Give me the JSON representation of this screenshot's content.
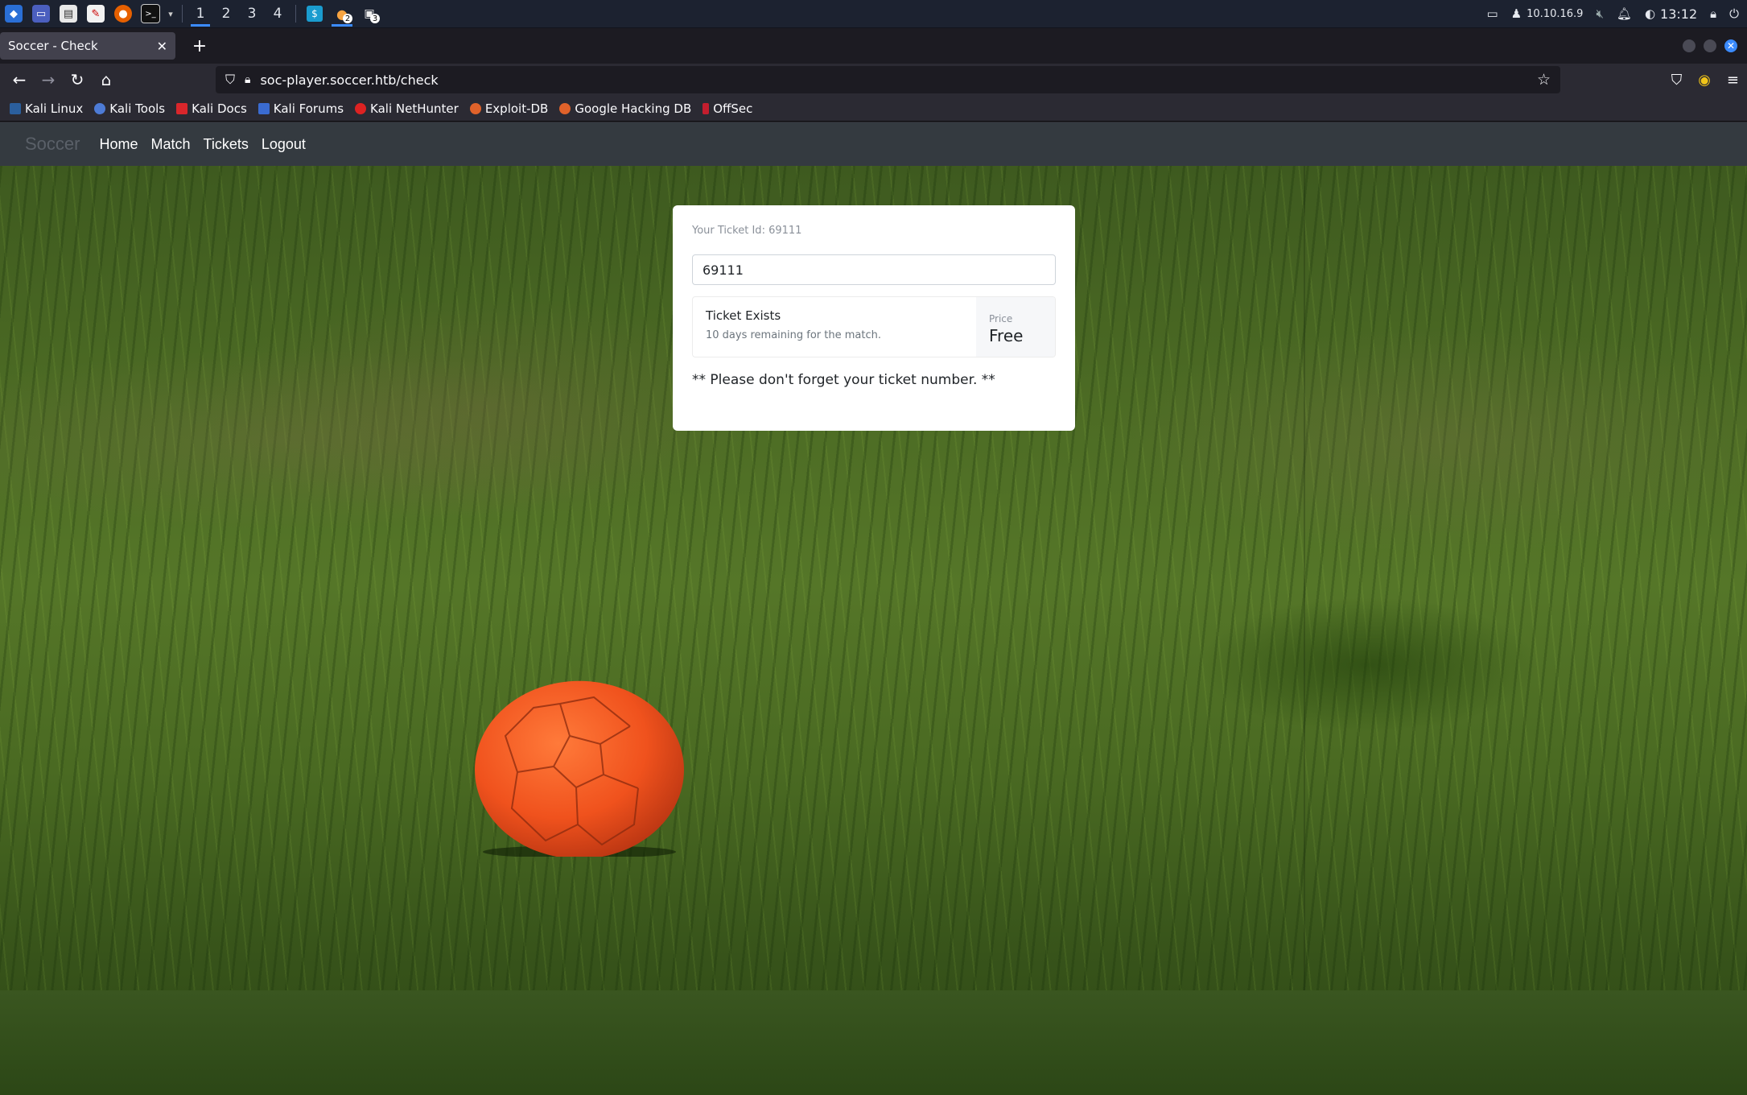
{
  "os_panel": {
    "workspaces": [
      "1",
      "2",
      "3",
      "4"
    ],
    "badges": {
      "app_a": "2",
      "app_b": "3"
    },
    "ip": "10.10.16.9",
    "clock": "13:12"
  },
  "browser": {
    "tab_title": "Soccer - Check",
    "url": "soc-player.soccer.htb/check",
    "bookmarks": [
      "Kali Linux",
      "Kali Tools",
      "Kali Docs",
      "Kali Forums",
      "Kali NetHunter",
      "Exploit-DB",
      "Google Hacking DB",
      "OffSec"
    ]
  },
  "site": {
    "brand": "Soccer",
    "nav": [
      "Home",
      "Match",
      "Tickets",
      "Logout"
    ]
  },
  "ticket": {
    "label": "Your Ticket Id: 69111",
    "input_value": "69111",
    "status_heading": "Ticket Exists",
    "status_sub": "10 days remaining for the match.",
    "price_label": "Price",
    "price_value": "Free",
    "note": "** Please don't forget your ticket number. **"
  },
  "colors": {
    "accent": "#3b8bff",
    "site_nav": "#343a40",
    "ball": "#f0521d"
  }
}
